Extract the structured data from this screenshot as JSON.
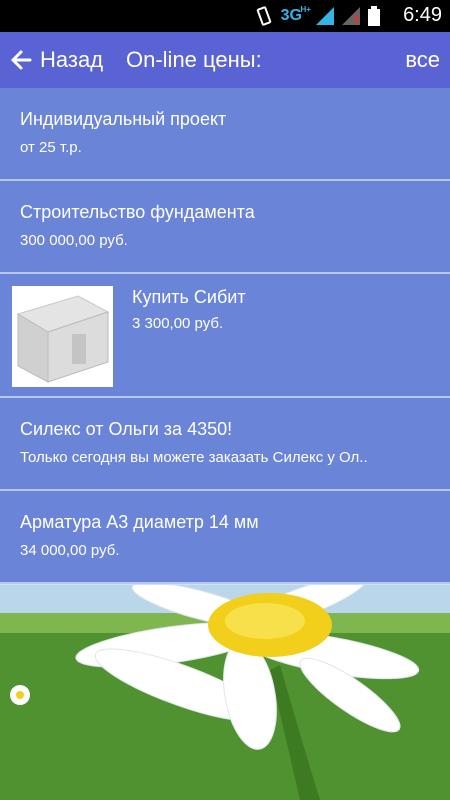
{
  "status": {
    "network": "3G",
    "network_sup": "H+",
    "time": "6:49"
  },
  "header": {
    "back_label": "Назад",
    "title": "On-line цены:",
    "all_label": "все"
  },
  "items": [
    {
      "title": "Индивидуальный проект",
      "subtitle": "от 25 т.р."
    },
    {
      "title": "Строительство фундамента",
      "subtitle": "300 000,00 руб."
    },
    {
      "title": "Купить Сибит",
      "subtitle": "3 300,00 руб."
    },
    {
      "title": "Силекс от Ольги за 4350!",
      "subtitle": "Только сегодня вы можете заказать Силекс у Ол.."
    },
    {
      "title": "Арматура А3 диаметр 14 мм",
      "subtitle": "34 000,00 руб."
    }
  ],
  "colors": {
    "action_bar": "#5a63d3",
    "row_bg": "#6a84d8",
    "network": "#33b5e5"
  }
}
